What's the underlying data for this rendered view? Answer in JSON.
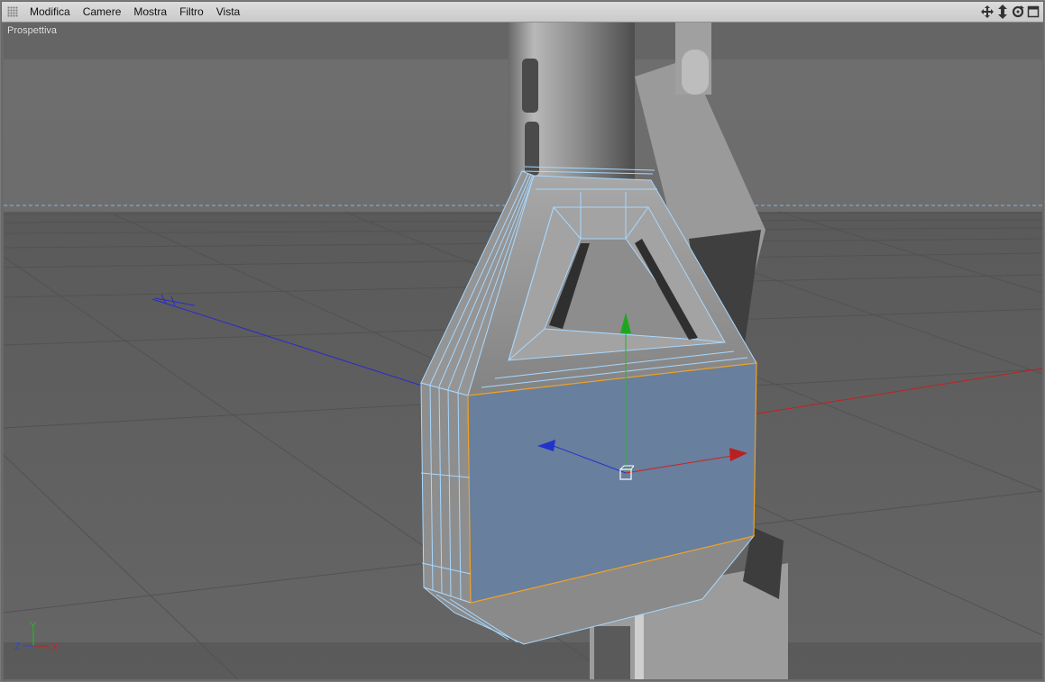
{
  "menubar": {
    "items": [
      {
        "label": "Modifica"
      },
      {
        "label": "Camere"
      },
      {
        "label": "Mostra"
      },
      {
        "label": "Filtro"
      },
      {
        "label": "Vista"
      }
    ],
    "nav_icons": [
      "move-view-icon",
      "dolly-view-icon",
      "rotate-view-icon",
      "maximize-view-icon"
    ]
  },
  "viewport": {
    "label": "Prospettiva",
    "axis_gizmo": {
      "y": "Y",
      "z": "Z",
      "x": "X"
    }
  },
  "colors": {
    "selected_polygon": "#687f9d",
    "edge_highlight": "#9fd0ff",
    "selection_outline": "#f0a020",
    "axis_x": "#cc2222",
    "axis_y": "#22bb22",
    "axis_z": "#2233cc"
  }
}
